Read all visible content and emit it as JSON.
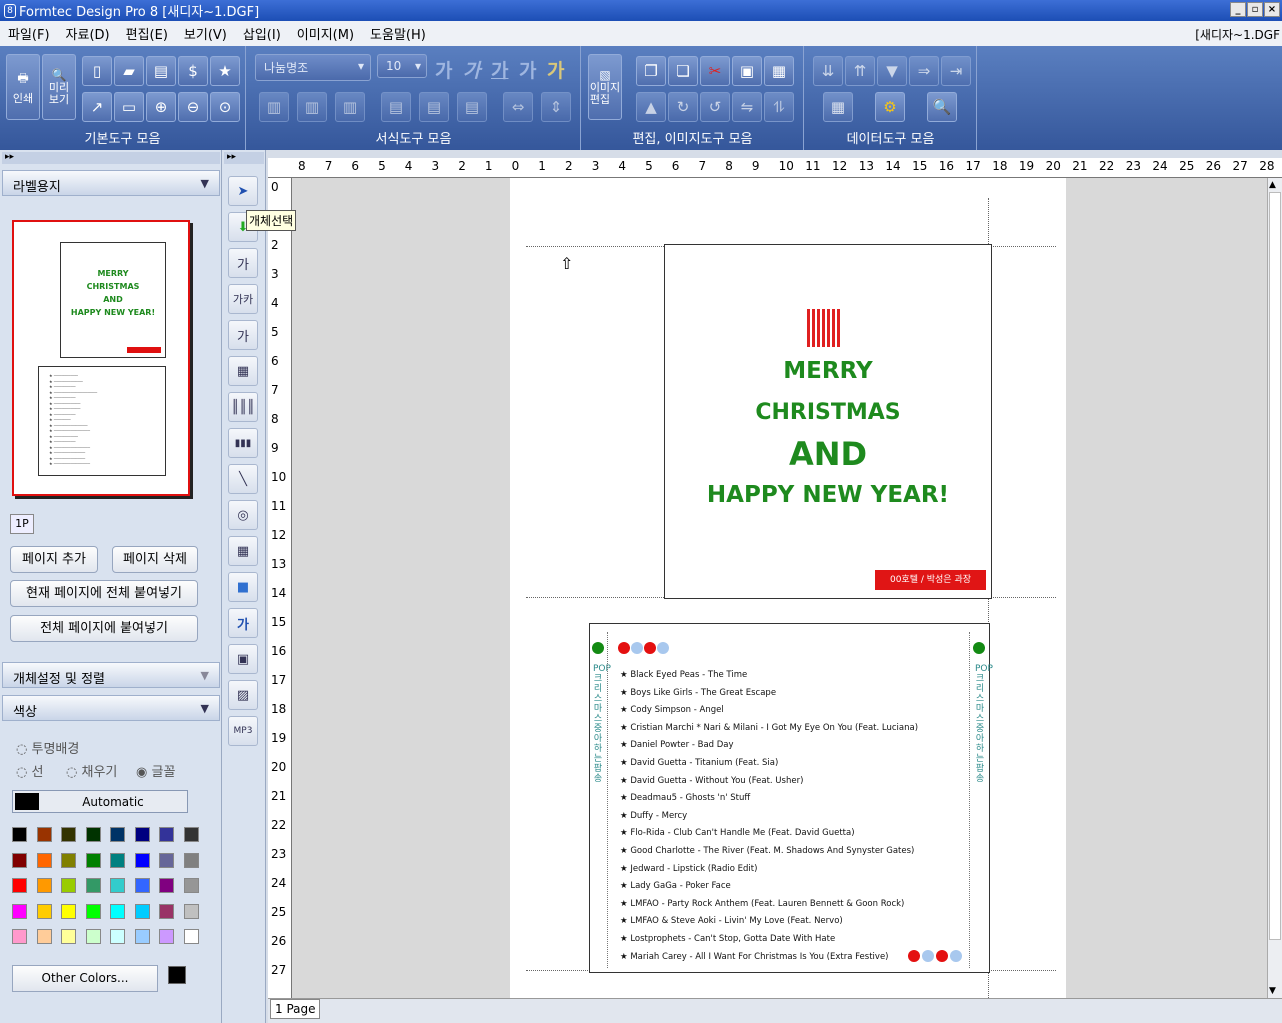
{
  "window": {
    "title": "Formtec Design Pro 8 [새디자~1.DGF]",
    "controls": [
      "_",
      "▫",
      "×"
    ]
  },
  "menu": {
    "items": [
      "파일(F)",
      "자료(D)",
      "편집(E)",
      "보기(V)",
      "삽입(I)",
      "이미지(M)",
      "도움말(H)"
    ],
    "document": "[새디자~1.DGF"
  },
  "toolbar": {
    "groups": [
      "기본도구 모음",
      "서식도구 모음",
      "편집, 이미지도구 모음",
      "데이터도구 모음"
    ],
    "print_label": "인쇄",
    "preview_label": "미리\n보기",
    "font_name": "나눔명조",
    "font_size": "10",
    "format_chars": [
      "가",
      "가",
      "가",
      "가",
      "가"
    ],
    "image_edit_label": "이미지\n편집"
  },
  "left_panel": {
    "label_paper": "라벨용지",
    "page_tab": "1P",
    "add_page": "페이지 추가",
    "delete_page": "페이지 삭제",
    "paste_current": "현재 페이지에 전체 붙여넣기",
    "paste_all": "전체 페이지에 붙여넣기",
    "object_settings": "개체설정 및 정렬",
    "color": "색상",
    "transparent": "투명배경",
    "line": "선",
    "fill": "채우기",
    "text": "글꼴",
    "automatic": "Automatic",
    "other_colors": "Other Colors...",
    "palette": [
      "#000000",
      "#993300",
      "#333300",
      "#003300",
      "#003366",
      "#000080",
      "#333399",
      "#333333",
      "#800000",
      "#ff6600",
      "#808000",
      "#008000",
      "#008080",
      "#0000ff",
      "#666699",
      "#808080",
      "#ff0000",
      "#ff9900",
      "#99cc00",
      "#339966",
      "#33cccc",
      "#3366ff",
      "#800080",
      "#969696",
      "#ff00ff",
      "#ffcc00",
      "#ffff00",
      "#00ff00",
      "#00ffff",
      "#00ccff",
      "#993366",
      "#c0c0c0",
      "#ff99cc",
      "#ffcc99",
      "#ffff99",
      "#ccffcc",
      "#ccffff",
      "#99ccff",
      "#cc99ff",
      "#ffffff"
    ]
  },
  "tool_tooltip": "개체선택",
  "tools": [
    "select-tool",
    "move-tool",
    "text-tool",
    "vertical-text-tool",
    "style-text-tool",
    "qr-code-tool",
    "barcode-tool",
    "barcode2-tool",
    "line-tool",
    "shape-tool",
    "table-tool",
    "gradient-tool",
    "wordart-tool",
    "image-tool",
    "picture-tool",
    "mp3-tool"
  ],
  "ruler": {
    "h": [
      "8",
      "7",
      "6",
      "5",
      "4",
      "3",
      "2",
      "1",
      "0",
      "1",
      "2",
      "3",
      "4",
      "5",
      "6",
      "7",
      "8",
      "9",
      "10",
      "11",
      "12",
      "13",
      "14",
      "15",
      "16",
      "17",
      "18",
      "19",
      "20",
      "21",
      "22",
      "23",
      "24",
      "25",
      "26",
      "27",
      "28"
    ],
    "v": [
      "0",
      "1",
      "2",
      "3",
      "4",
      "5",
      "6",
      "7",
      "8",
      "9",
      "10",
      "11",
      "12",
      "13",
      "14",
      "15",
      "16",
      "17",
      "18",
      "19",
      "20",
      "21",
      "22",
      "23",
      "24",
      "25",
      "26",
      "27"
    ]
  },
  "card_front": {
    "line1": "MERRY",
    "line2": "CHRISTMAS",
    "line3": "AND",
    "line4": "HAPPY NEW YEAR!",
    "tag": "00호텔 / 박성은 과장"
  },
  "card_back": {
    "side_left": "POP 크리스마스 중아하는 팝송",
    "songs": [
      "Black Eyed Peas - The Time",
      "Boys Like Girls - The Great Escape",
      "Cody Simpson - Angel",
      "Cristian Marchi * Nari & Milani - I Got My Eye On You (Feat. Luciana)",
      "Daniel Powter - Bad Day",
      "David Guetta - Titanium (Feat. Sia)",
      "David Guetta - Without You (Feat. Usher)",
      "Deadmau5 - Ghosts 'n' Stuff",
      "Duffy - Mercy",
      "Flo-Rida - Club Can't Handle Me (Feat. David Guetta)",
      "Good Charlotte - The River (Feat. M. Shadows And Synyster Gates)",
      "Jedward - Lipstick (Radio Edit)",
      "Lady GaGa - Poker Face",
      "LMFAO - Party Rock Anthem (Feat. Lauren Bennett & Goon Rock)",
      "LMFAO & Steve Aoki - Livin' My Love (Feat. Nervo)",
      "Lostprophets - Can't Stop, Gotta Date With Hate",
      "Mariah Carey - All I Want For Christmas Is You (Extra Festive)"
    ]
  },
  "status": {
    "page": "1 Page"
  }
}
